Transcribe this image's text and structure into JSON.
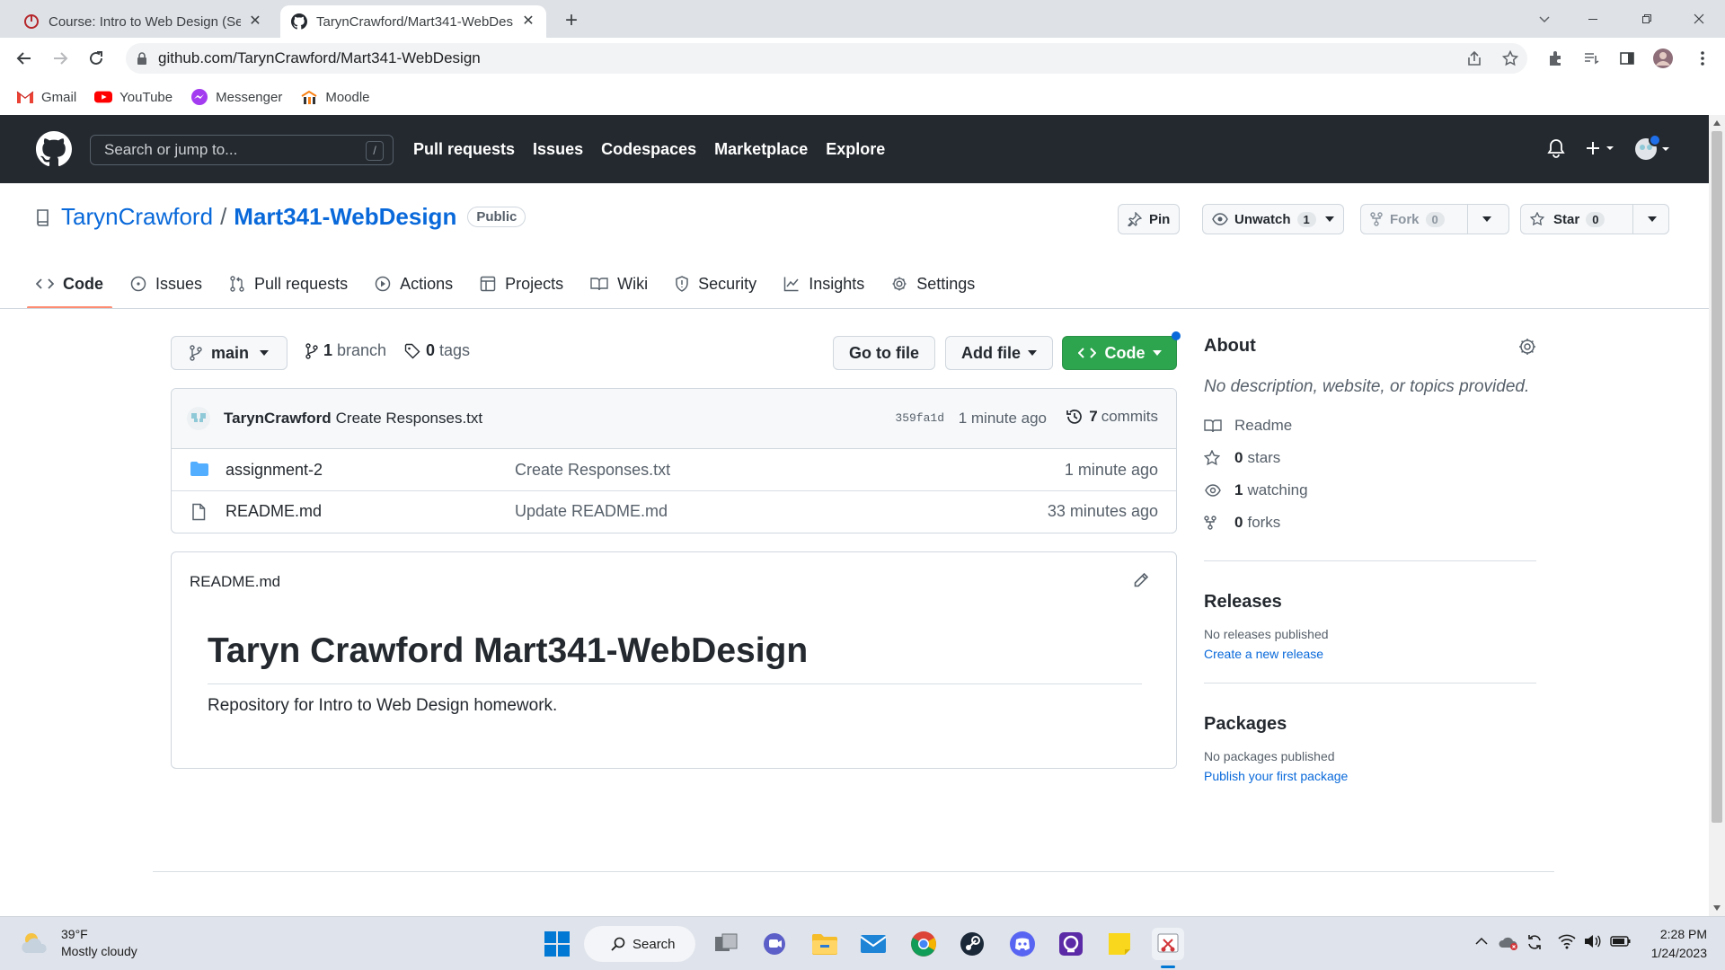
{
  "browser": {
    "tabs": [
      {
        "title": "Course: Intro to Web Design (Sec",
        "active": false
      },
      {
        "title": "TarynCrawford/Mart341-WebDes",
        "active": true
      }
    ],
    "url": "github.com/TarynCrawford/Mart341-WebDesign",
    "bookmarks": [
      {
        "label": "Gmail",
        "icon": "gmail-icon"
      },
      {
        "label": "YouTube",
        "icon": "youtube-icon"
      },
      {
        "label": "Messenger",
        "icon": "messenger-icon"
      },
      {
        "label": "Moodle",
        "icon": "moodle-icon"
      }
    ]
  },
  "github_header": {
    "search_placeholder": "Search or jump to...",
    "search_shortcut": "/",
    "nav": [
      "Pull requests",
      "Issues",
      "Codespaces",
      "Marketplace",
      "Explore"
    ]
  },
  "repo": {
    "owner": "TarynCrawford",
    "separator": "/",
    "name": "Mart341-WebDesign",
    "visibility": "Public",
    "actions": {
      "pin": "Pin",
      "unwatch": "Unwatch",
      "watch_count": "1",
      "fork": "Fork",
      "fork_count": "0",
      "star": "Star",
      "star_count": "0"
    },
    "tabs": [
      "Code",
      "Issues",
      "Pull requests",
      "Actions",
      "Projects",
      "Wiki",
      "Security",
      "Insights",
      "Settings"
    ],
    "selected_tab": "Code"
  },
  "code": {
    "branch": "main",
    "branch_count": "1",
    "branch_label": "branch",
    "tag_count": "0",
    "tag_label": "tags",
    "go_to_file": "Go to file",
    "add_file": "Add file",
    "code_button": "Code",
    "latest_commit": {
      "author": "TarynCrawford",
      "message": "Create Responses.txt",
      "sha": "359fa1d",
      "time": "1 minute ago",
      "commit_count": "7",
      "commit_label": "commits"
    },
    "files": [
      {
        "type": "folder",
        "name": "assignment-2",
        "message": "Create Responses.txt",
        "age": "1 minute ago"
      },
      {
        "type": "file",
        "name": "README.md",
        "message": "Update README.md",
        "age": "33 minutes ago"
      }
    ]
  },
  "readme": {
    "filename": "README.md",
    "heading": "Taryn Crawford Mart341-WebDesign",
    "body": "Repository for Intro to Web Design homework."
  },
  "about": {
    "title": "About",
    "description": "No description, website, or topics provided.",
    "readme_label": "Readme",
    "stars_count": "0",
    "stars_label": "stars",
    "watching_count": "1",
    "watching_label": "watching",
    "forks_count": "0",
    "forks_label": "forks"
  },
  "releases": {
    "title": "Releases",
    "status": "No releases published",
    "link": "Create a new release"
  },
  "packages": {
    "title": "Packages",
    "status": "No packages published",
    "link": "Publish your first package"
  },
  "taskbar": {
    "weather_temp": "39°F",
    "weather_desc": "Mostly cloudy",
    "search_label": "Search",
    "time": "2:28 PM",
    "date": "1/24/2023"
  },
  "colors": {
    "header_bg": "#24292f",
    "link": "#0969da",
    "code_button": "#2da44e",
    "selected_tab_underline": "#fd8c73"
  }
}
